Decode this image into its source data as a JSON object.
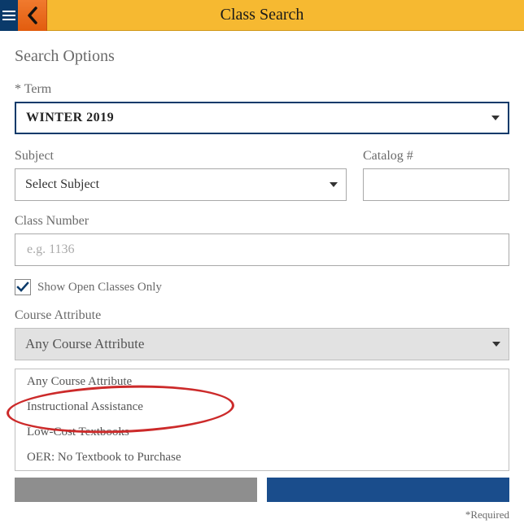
{
  "header": {
    "title": "Class Search"
  },
  "section_heading": "Search Options",
  "term": {
    "label": "* Term",
    "value": "WINTER 2019"
  },
  "subject": {
    "label": "Subject",
    "value": "Select Subject"
  },
  "catalog": {
    "label": "Catalog #",
    "value": ""
  },
  "class_number": {
    "label": "Class Number",
    "placeholder": "e.g. 1136",
    "value": ""
  },
  "open_only": {
    "label": "Show Open Classes Only",
    "checked": true
  },
  "course_attribute": {
    "label": "Course Attribute",
    "selected": "Any Course Attribute",
    "options": [
      "Any Course Attribute",
      "Instructional Assistance",
      "Low-Cost Textbooks",
      "OER: No Textbook to Purchase"
    ]
  },
  "buttons": {
    "reset": "",
    "search": ""
  },
  "required_note": "*Required",
  "colors": {
    "header_bg": "#f6b931",
    "accent_orange": "#e9671b",
    "accent_navy": "#0a3a6a",
    "annotation_red": "#cc2a2a"
  }
}
